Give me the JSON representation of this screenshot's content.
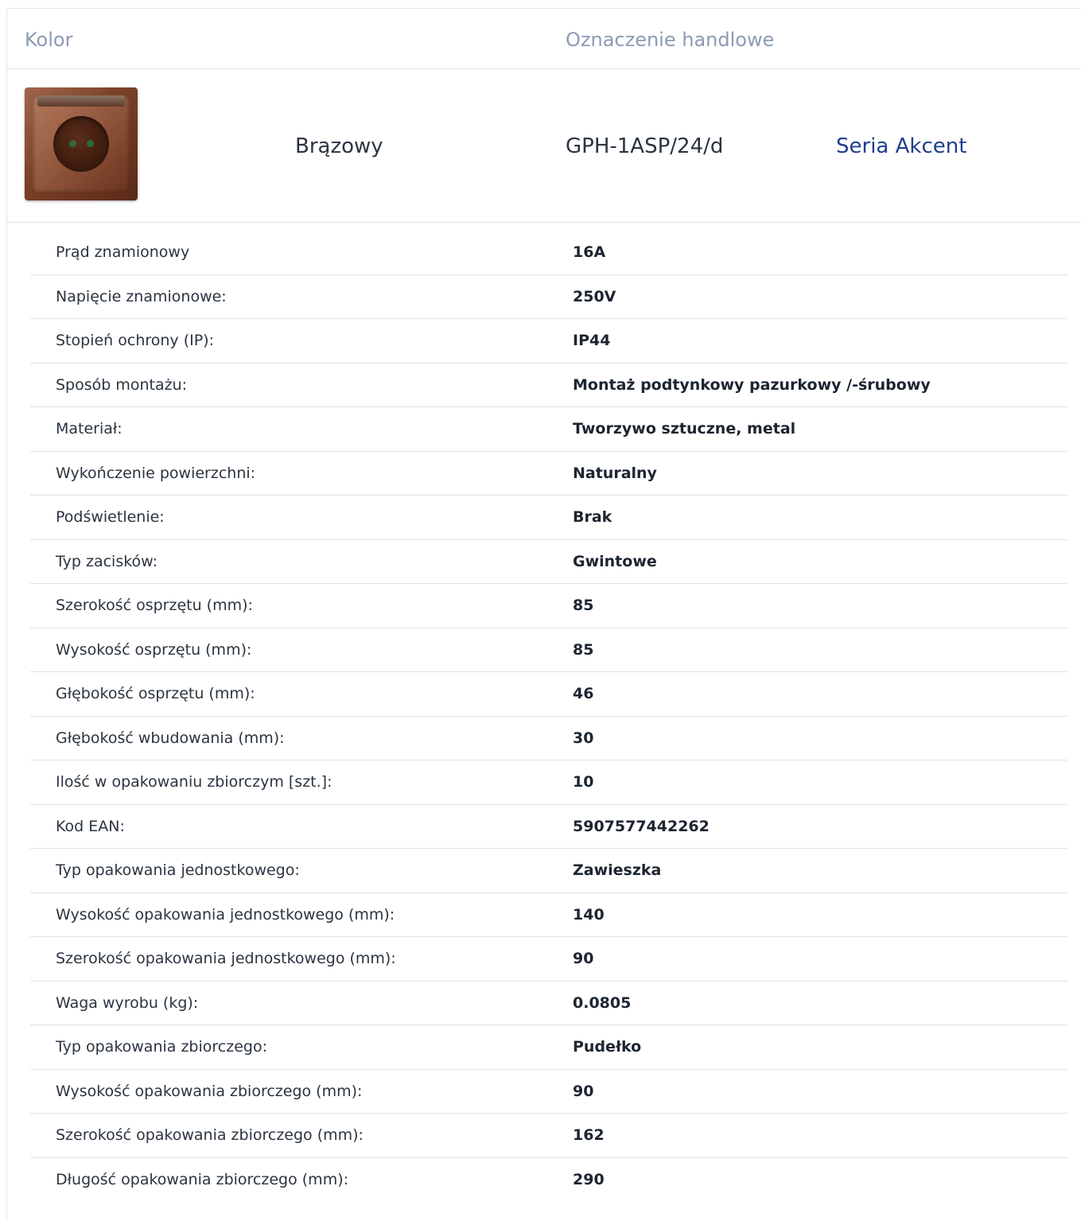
{
  "header": {
    "color_label": "Kolor",
    "designation_label": "Oznaczenie handlowe"
  },
  "product": {
    "thumbnail": "brown-socket-image",
    "color_name": "Brązowy",
    "code": "GPH-1ASP/24/d",
    "series_link": "Seria Akcent"
  },
  "colors": {
    "header_text": "#8a9bb5",
    "link": "#1f3f8a",
    "divider": "#dfe3e8"
  },
  "specs": [
    {
      "label": "Prąd znamionowy",
      "value": "16A"
    },
    {
      "label": "Napięcie znamionowe:",
      "value": "250V"
    },
    {
      "label": "Stopień ochrony (IP):",
      "value": "IP44"
    },
    {
      "label": "Sposób montażu:",
      "value": "Montaż podtynkowy pazurkowy /-śrubowy"
    },
    {
      "label": "Materiał:",
      "value": "Tworzywo sztuczne, metal"
    },
    {
      "label": "Wykończenie powierzchni:",
      "value": "Naturalny"
    },
    {
      "label": "Podświetlenie:",
      "value": "Brak"
    },
    {
      "label": "Typ zacisków:",
      "value": "Gwintowe"
    },
    {
      "label": "Szerokość osprzętu (mm):",
      "value": "85"
    },
    {
      "label": "Wysokość osprzętu (mm):",
      "value": "85"
    },
    {
      "label": "Głębokość osprzętu (mm):",
      "value": "46"
    },
    {
      "label": "Głębokość wbudowania (mm):",
      "value": "30"
    },
    {
      "label": "Ilość w opakowaniu zbiorczym [szt.]:",
      "value": "10"
    },
    {
      "label": "Kod EAN:",
      "value": "5907577442262"
    },
    {
      "label": "Typ opakowania jednostkowego:",
      "value": "Zawieszka"
    },
    {
      "label": "Wysokość opakowania jednostkowego (mm):",
      "value": "140"
    },
    {
      "label": "Szerokość opakowania jednostkowego (mm):",
      "value": "90"
    },
    {
      "label": "Waga wyrobu (kg):",
      "value": "0.0805"
    },
    {
      "label": "Typ opakowania zbiorczego:",
      "value": "Pudełko"
    },
    {
      "label": "Wysokość opakowania zbiorczego (mm):",
      "value": "90"
    },
    {
      "label": "Szerokość opakowania zbiorczego (mm):",
      "value": "162"
    },
    {
      "label": "Długość opakowania zbiorczego (mm):",
      "value": "290"
    }
  ]
}
